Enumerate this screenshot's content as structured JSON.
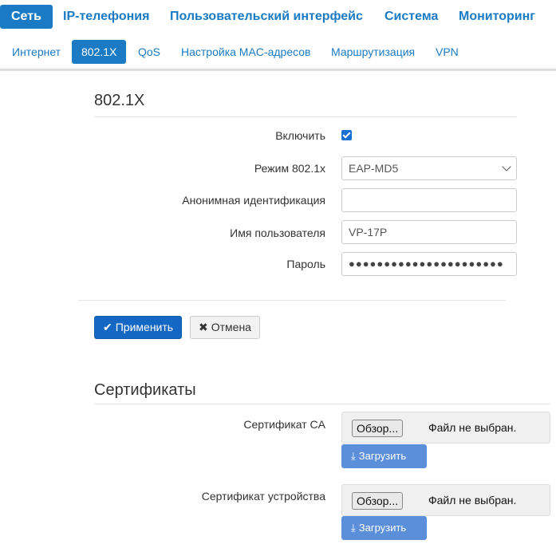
{
  "topnav": {
    "items": [
      "Сеть",
      "IP-телефония",
      "Пользовательский интерфейс",
      "Система",
      "Мониторинг"
    ],
    "active": "Сеть"
  },
  "subnav": {
    "items": [
      "Интернет",
      "802.1X",
      "QoS",
      "Настройка MAC-адресов",
      "Маршрутизация",
      "VPN"
    ],
    "active": "802.1X"
  },
  "section1": {
    "title": "802.1X",
    "enable_label": "Включить",
    "enable_checked": true,
    "mode_label": "Режим 802.1x",
    "mode_value": "EAP-MD5",
    "anon_label": "Анонимная идентификация",
    "anon_value": "",
    "user_label": "Имя пользователя",
    "user_value": "VP-17P",
    "password_label": "Пароль",
    "password_value": "●●●●●●●●●●●●●●●●●●●●●●"
  },
  "actions": {
    "apply_label": "Применить",
    "cancel_label": "Отмена"
  },
  "section2": {
    "title": "Сертификаты",
    "ca_label": "Сертификат CA",
    "device_label": "Сертификат устройства",
    "browse_label": "Обзор...",
    "no_file_label": "Файл не выбран.",
    "upload_label": "Загрузить"
  },
  "colors": {
    "accent": "#1a7bc4",
    "primary_button": "#1467c2",
    "upload_button": "#5b8fd9"
  }
}
